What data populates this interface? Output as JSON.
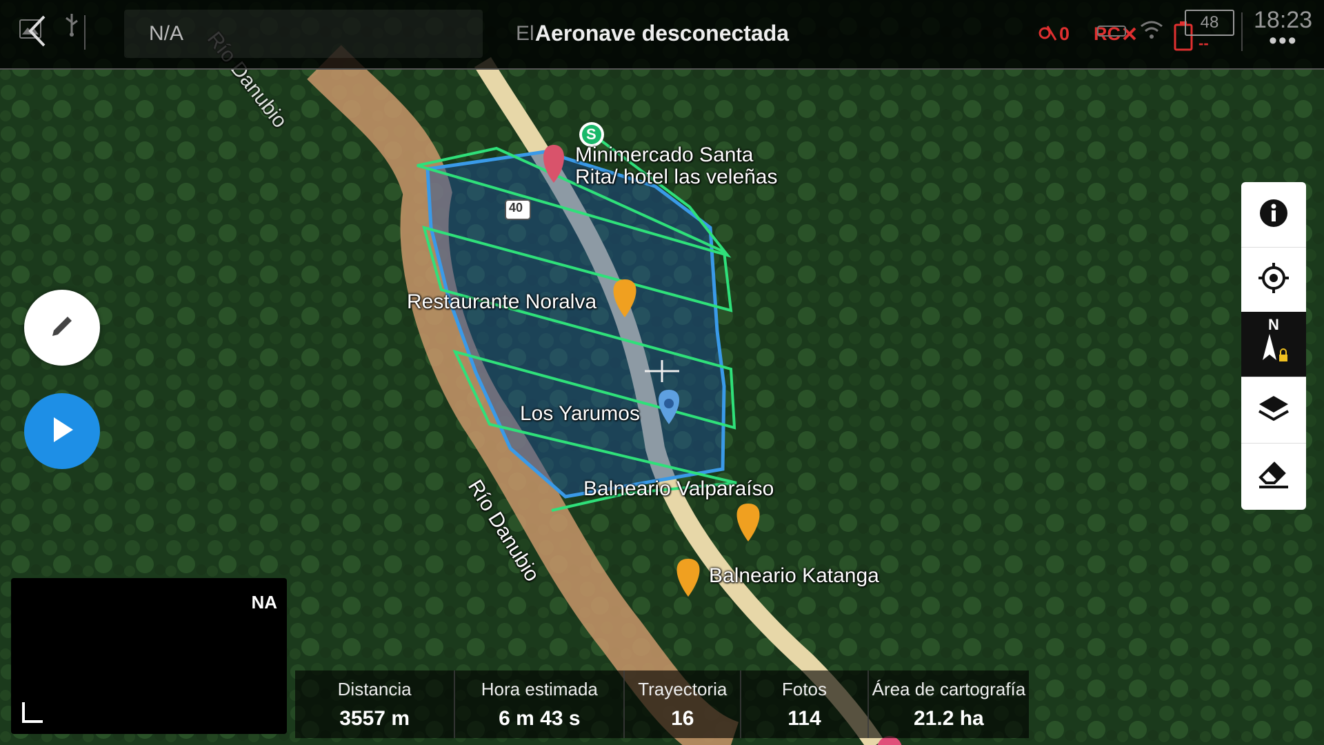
{
  "header": {
    "search_placeholder": "N/A",
    "status_title": "Aeronave desconectada",
    "hidden_poi": "El",
    "signal_count": "0",
    "rc_label": "RC",
    "aircraft_battery": "--",
    "battery_level": "48",
    "time": "18:23",
    "more": "•••"
  },
  "map": {
    "labels": {
      "minimercado": "Minimercado Santa",
      "minimercado_2": "Rita/ hotel las veleñas",
      "restaurante": "Restaurante Noralva",
      "yarumos": "Los Yarumos",
      "valparaiso": "Balneario Valparaíso",
      "katanga": "Balneario Katanga",
      "rio_1": "Río Danubio",
      "rio_2": "Río Danubio",
      "route": "40",
      "start_marker": "S"
    }
  },
  "right_toolbar": {
    "compass_label": "N"
  },
  "preview": {
    "label": "NA"
  },
  "stats": [
    {
      "label": "Distancia",
      "value": "3557 m"
    },
    {
      "label": "Hora estimada",
      "value": "6 m 43 s"
    },
    {
      "label": "Trayectoria",
      "value": "16"
    },
    {
      "label": "Fotos",
      "value": "114"
    },
    {
      "label": "Área de cartografía",
      "value": "21.2 ha"
    }
  ],
  "colors": {
    "area_fill": "#1f4fa0",
    "area_border": "#3a9ae8",
    "flight_path": "#2fe07a",
    "play_button": "#1e8fe6",
    "warning": "#e03030"
  }
}
